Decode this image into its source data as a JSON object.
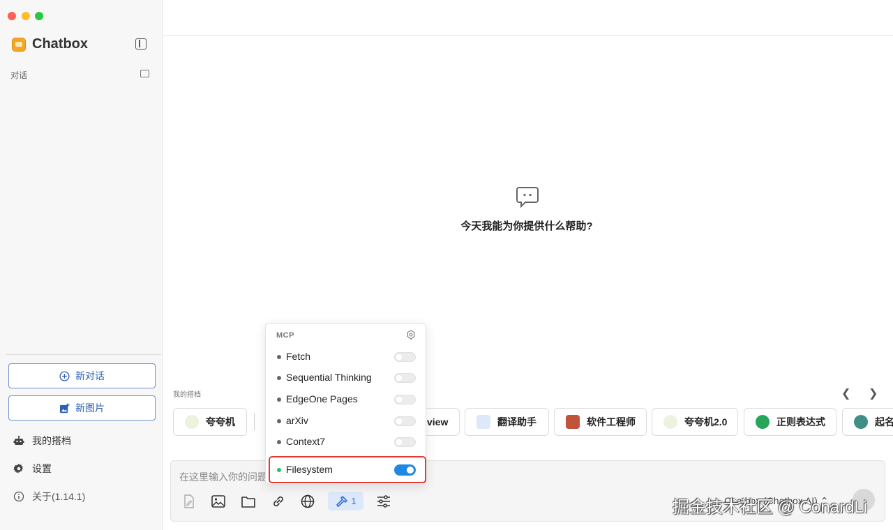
{
  "window": {
    "traffic_colors": [
      "#ff5f57",
      "#febc2e",
      "#28c840"
    ]
  },
  "sidebar": {
    "app_title": "Chatbox",
    "section_label": "对话",
    "new_chat": "新对话",
    "new_image": "新图片",
    "items": [
      {
        "label": "我的搭档",
        "icon": "robot-icon"
      },
      {
        "label": "设置",
        "icon": "gear-icon"
      },
      {
        "label": "关于(1.14.1)",
        "icon": "info-icon"
      }
    ]
  },
  "main": {
    "welcome_text": "今天我能为你提供什么帮助?",
    "copilots_label": "我的搭档",
    "copilots": [
      {
        "name": "夸夸机"
      },
      {
        "name": "view"
      },
      {
        "name": "翻译助手"
      },
      {
        "name": "软件工程师"
      },
      {
        "name": "夸夸机2.0"
      },
      {
        "name": "正则表达式"
      },
      {
        "name": "起名"
      }
    ]
  },
  "input": {
    "placeholder": "在这里输入你的问题",
    "mcp_count": "1",
    "model": "Chatbox (Chatbox AI) ⌃",
    "watermark": "掘金技术社区 @ ConardLi"
  },
  "mcp_popover": {
    "title": "MCP",
    "servers": [
      {
        "name": "Fetch",
        "enabled": false
      },
      {
        "name": "Sequential Thinking",
        "enabled": false
      },
      {
        "name": "EdgeOne Pages",
        "enabled": false
      },
      {
        "name": "arXiv",
        "enabled": false
      },
      {
        "name": "Context7",
        "enabled": false
      },
      {
        "name": "Filesystem",
        "enabled": true
      }
    ]
  },
  "colors": {
    "accent": "#1e88e5",
    "highlight": "#e53935",
    "active_dot": "#22c55e"
  }
}
